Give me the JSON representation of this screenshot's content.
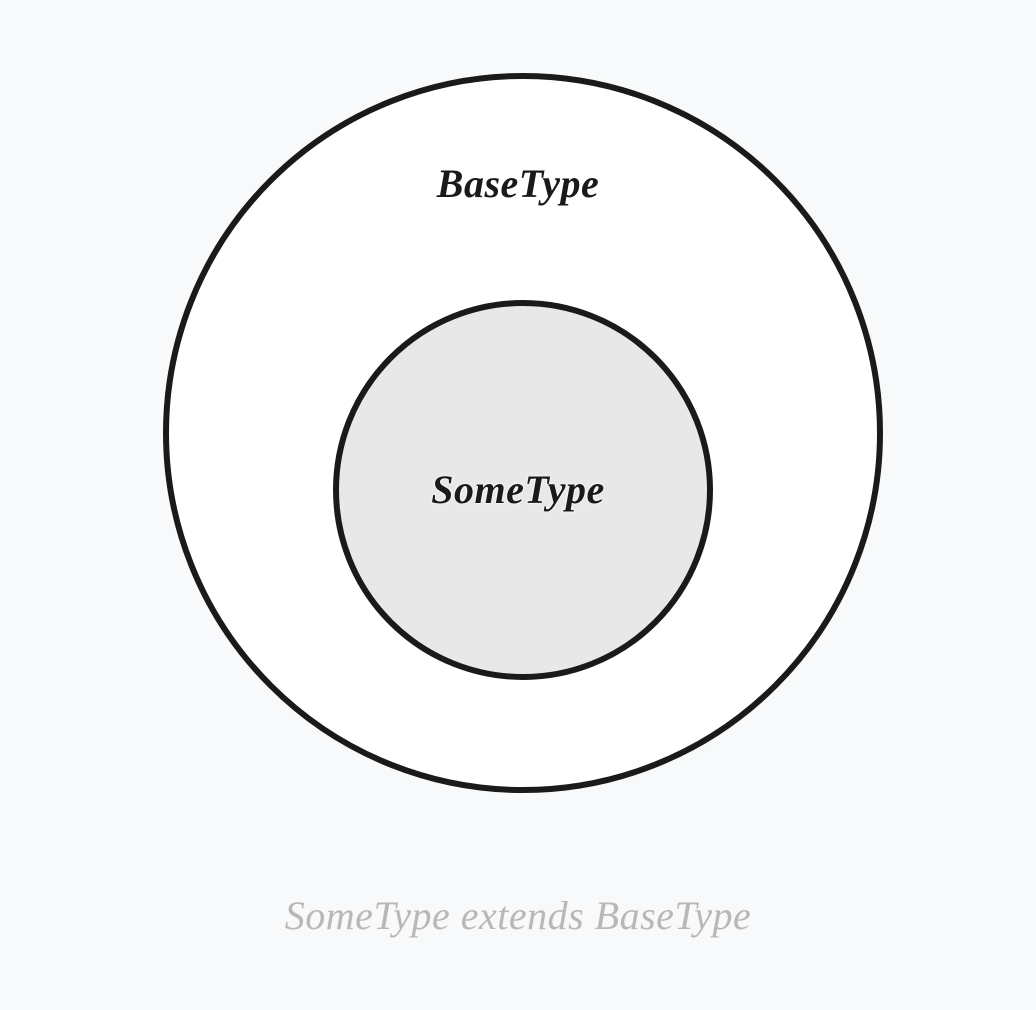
{
  "diagram": {
    "outer_label": "BaseType",
    "inner_label": "SomeType",
    "caption": "SomeType extends BaseType"
  },
  "colors": {
    "background": "#f8f9fa",
    "circle_stroke": "#1a1a1a",
    "outer_fill": "#ffffff",
    "inner_fill": "#e8e8e8",
    "text": "#1a1a1a",
    "caption": "#b8b8b8"
  }
}
